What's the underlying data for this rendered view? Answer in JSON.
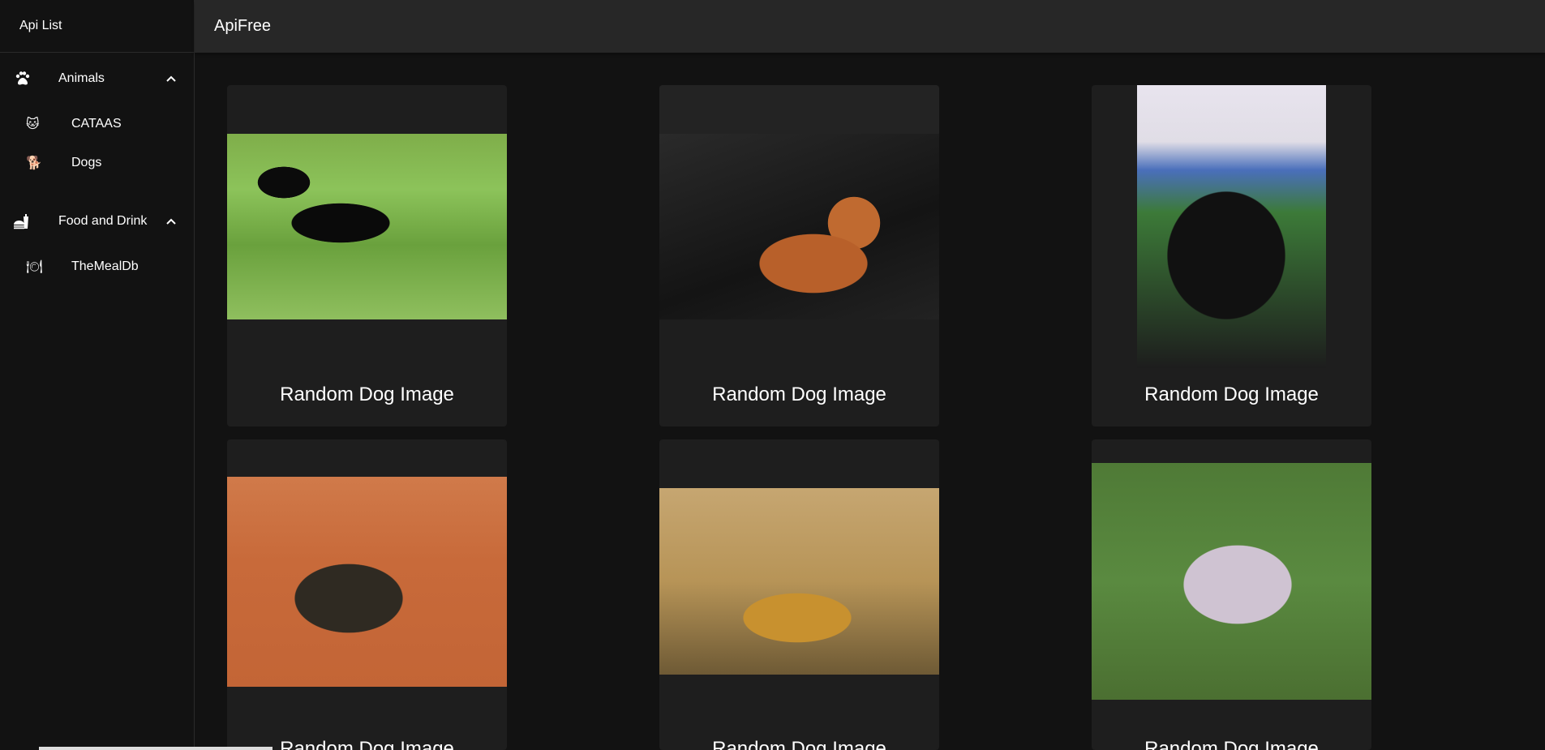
{
  "sidebar": {
    "title": "Api List",
    "groups": [
      {
        "label": "Animals",
        "items": [
          {
            "label": "CATAAS",
            "icon": "🐱"
          },
          {
            "label": "Dogs",
            "icon": "🐕"
          }
        ]
      },
      {
        "label": "Food and Drink",
        "items": [
          {
            "label": "TheMealDb",
            "icon": "🍽"
          }
        ]
      }
    ]
  },
  "topbar": {
    "title": "ApiFree"
  },
  "cards": [
    {
      "caption": "Random Dog Image"
    },
    {
      "caption": "Random Dog Image"
    },
    {
      "caption": "Random Dog Image"
    },
    {
      "caption": "Random Dog Image"
    },
    {
      "caption": "Random Dog Image"
    },
    {
      "caption": "Random Dog Image"
    }
  ]
}
